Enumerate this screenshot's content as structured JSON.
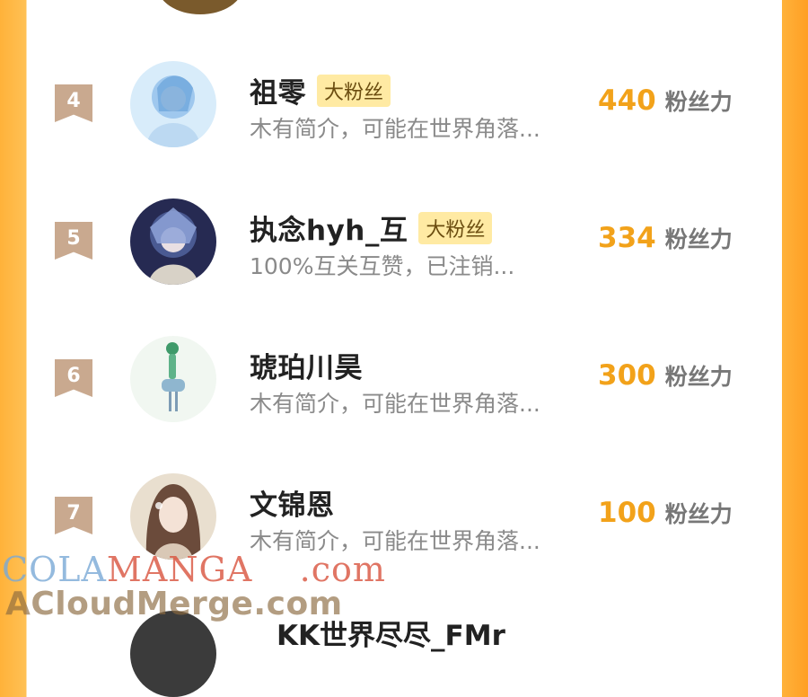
{
  "list": [
    {
      "rank": "4",
      "name": "祖零",
      "tag": "大粉丝",
      "bio": "木有简介，可能在世界角落...",
      "score": "440",
      "unit": "粉丝力",
      "avatar_color": "#cfe6f7"
    },
    {
      "rank": "5",
      "name": "执念hyh_互",
      "tag": "大粉丝",
      "bio": "100%互关互赞，已注销...",
      "score": "334",
      "unit": "粉丝力",
      "avatar_color": "#2b2f5c"
    },
    {
      "rank": "6",
      "name": "琥珀川昊",
      "tag": "",
      "bio": "木有简介，可能在世界角落...",
      "score": "300",
      "unit": "粉丝力",
      "avatar_color": "#eef6ee"
    },
    {
      "rank": "7",
      "name": "文锦恩",
      "tag": "",
      "bio": "木有简介，可能在世界角落...",
      "score": "100",
      "unit": "粉丝力",
      "avatar_color": "#e8dccb"
    }
  ],
  "partial_next": {
    "name": "KK世界尽尽_FMr"
  },
  "watermark": {
    "line1_a": "COLA",
    "line1_b": "MANGA",
    "line1_c": ".com",
    "line2": "ACloudMerge.com"
  }
}
